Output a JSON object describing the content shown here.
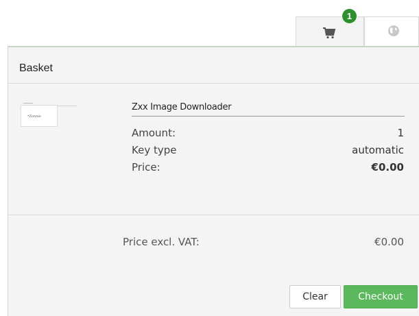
{
  "tabs": {
    "cart_icon": "shopping-cart-icon",
    "globe_icon": "globe-icon",
    "badge_count": "1"
  },
  "basket": {
    "title": "Basket",
    "item": {
      "name": "Zxx Image Downloader",
      "thumbnail_text": "*Zonnie",
      "rows": [
        {
          "label": "Amount:",
          "value": "1"
        },
        {
          "label": "Key type",
          "value": "automatic"
        },
        {
          "label": "Price:",
          "value": "€0.00"
        }
      ]
    },
    "price_excl_vat_label": "Price excl. VAT:",
    "price_excl_vat_value": "€0.00",
    "clear_label": "Clear",
    "checkout_label": "Checkout"
  },
  "colors": {
    "accent": "#5cb85c",
    "badge": "#2e8f2e",
    "panel_bg": "#f4f4f4"
  }
}
